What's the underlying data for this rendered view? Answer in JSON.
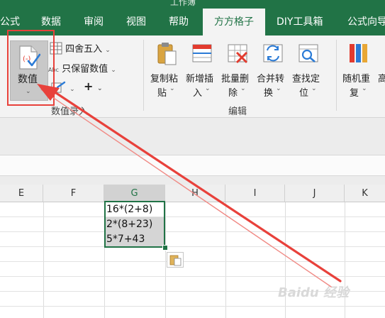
{
  "window": {
    "title": "工作簿"
  },
  "ribbon_tabs": [
    {
      "label": "公式"
    },
    {
      "label": "数据"
    },
    {
      "label": "审阅"
    },
    {
      "label": "视图"
    },
    {
      "label": "帮助"
    },
    {
      "label": "方方格子",
      "active": true
    },
    {
      "label": "DIY工具箱"
    },
    {
      "label": "公式向导"
    }
  ],
  "ribbon": {
    "numeric_group": {
      "big_button_label": "数值",
      "round_label": "四舍五入",
      "keep_value_label": "只保留数值",
      "plus_label": "+",
      "group_name": "数值录入"
    },
    "edit_group": {
      "buttons": [
        {
          "line1": "复制粘",
          "line2": "贴"
        },
        {
          "line1": "新增插",
          "line2": "入"
        },
        {
          "line1": "批量删",
          "line2": "除"
        },
        {
          "line1": "合并转",
          "line2": "换"
        },
        {
          "line1": "查找定",
          "line2": "位"
        }
      ],
      "group_name": "编辑"
    },
    "random_group": {
      "button": {
        "line1": "随机重",
        "line2": "复"
      },
      "partial_label": "高"
    }
  },
  "columns": [
    "E",
    "F",
    "G",
    "H",
    "I",
    "J",
    "K"
  ],
  "selected_column": "G",
  "cells": [
    {
      "ref": "G1",
      "value": "16*(2+8)"
    },
    {
      "ref": "G2",
      "value": "2*(8+23)"
    },
    {
      "ref": "G3",
      "value": "5*7+43"
    }
  ],
  "watermark": "Baidu 经验",
  "colors": {
    "ribbon_green": "#217346",
    "annotation_red": "#e8413b"
  }
}
